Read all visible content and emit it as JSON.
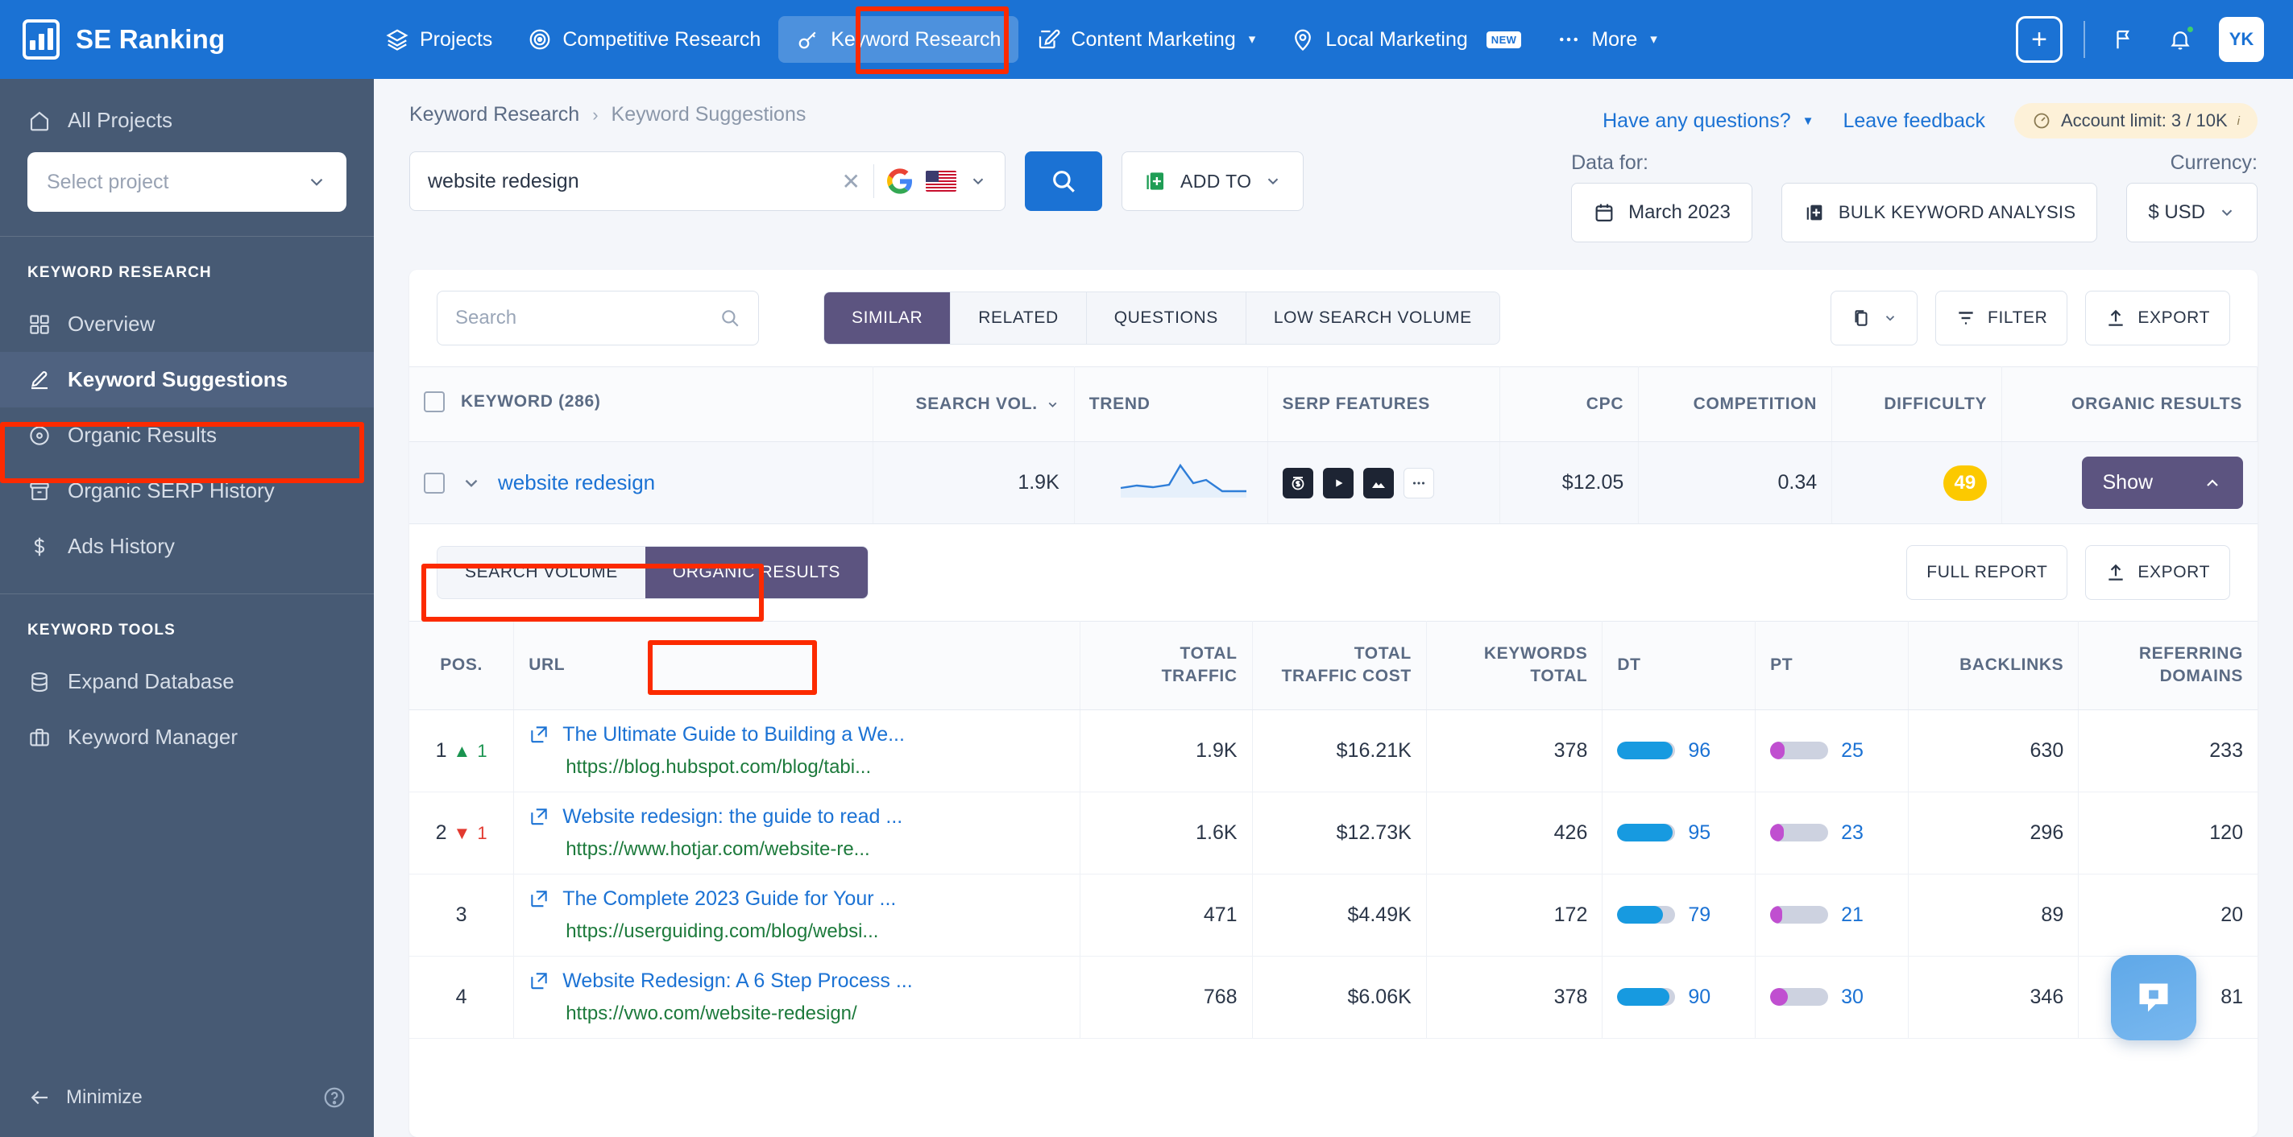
{
  "topnav": {
    "brand": "SE Ranking",
    "items": [
      {
        "label": "Projects",
        "icon": "layers-icon",
        "caret": false,
        "badge": null,
        "active": false
      },
      {
        "label": "Competitive Research",
        "icon": "target-icon",
        "caret": false,
        "badge": null,
        "active": false
      },
      {
        "label": "Keyword Research",
        "icon": "key-icon",
        "caret": false,
        "badge": null,
        "active": true
      },
      {
        "label": "Content Marketing",
        "icon": "pen-square-icon",
        "caret": true,
        "badge": null,
        "active": false
      },
      {
        "label": "Local Marketing",
        "icon": "map-pin-icon",
        "caret": false,
        "badge": "NEW",
        "active": false
      },
      {
        "label": "More",
        "icon": "ellipsis-icon",
        "caret": true,
        "badge": null,
        "active": false
      }
    ],
    "plus": "+",
    "avatar": "YK"
  },
  "sidebar": {
    "all_projects": "All Projects",
    "project_select_placeholder": "Select project",
    "group1_title": "KEYWORD RESEARCH",
    "group1_items": [
      {
        "label": "Overview",
        "icon": "grid-icon",
        "active": false
      },
      {
        "label": "Keyword Suggestions",
        "icon": "pencil-icon",
        "active": true
      },
      {
        "label": "Organic Results",
        "icon": "circle-dot-icon",
        "active": false
      },
      {
        "label": "Organic SERP History",
        "icon": "archive-icon",
        "active": false
      },
      {
        "label": "Ads History",
        "icon": "dollar-icon",
        "active": false
      }
    ],
    "group2_title": "KEYWORD TOOLS",
    "group2_items": [
      {
        "label": "Expand Database",
        "icon": "database-icon",
        "active": false
      },
      {
        "label": "Keyword Manager",
        "icon": "briefcase-icon",
        "active": false
      }
    ],
    "minimize": "Minimize"
  },
  "header": {
    "breadcrumb_root": "Keyword Research",
    "breadcrumb_current": "Keyword Suggestions",
    "have_questions": "Have any questions?",
    "leave_feedback": "Leave feedback",
    "account_limit": "Account limit: 3 / 10K"
  },
  "search": {
    "keyword_value": "website redesign",
    "clear": "✕",
    "add_to": "ADD TO",
    "data_for_label": "Data for:",
    "date_value": "March 2023",
    "bulk_analysis": "BULK KEYWORD ANALYSIS",
    "currency_label": "Currency:",
    "currency_value": "$ USD"
  },
  "toolbar": {
    "search_placeholder": "Search",
    "tabs": [
      {
        "label": "SIMILAR",
        "active": true
      },
      {
        "label": "RELATED",
        "active": false
      },
      {
        "label": "QUESTIONS",
        "active": false
      },
      {
        "label": "LOW SEARCH VOLUME",
        "active": false
      }
    ],
    "filter": "FILTER",
    "export": "EXPORT"
  },
  "keyword_table": {
    "columns": [
      "KEYWORD  (286)",
      "SEARCH VOL.",
      "TREND",
      "SERP FEATURES",
      "CPC",
      "COMPETITION",
      "DIFFICULTY",
      "ORGANIC RESULTS"
    ],
    "row": {
      "keyword": "website redesign",
      "search_volume": "1.9K",
      "serp_features": [
        "price-icon",
        "video-icon",
        "image-icon",
        "more-icon"
      ],
      "cpc": "$12.05",
      "competition": "0.34",
      "difficulty": "49",
      "show_button": "Show"
    }
  },
  "detail": {
    "subtabs": [
      {
        "label": "SEARCH VOLUME",
        "active": false
      },
      {
        "label": "ORGANIC RESULTS",
        "active": true
      }
    ],
    "full_report": "FULL REPORT",
    "export": "EXPORT",
    "columns": [
      "POS.",
      "URL",
      "TOTAL TRAFFIC",
      "TOTAL TRAFFIC COST",
      "KEYWORDS TOTAL",
      "DT",
      "PT",
      "BACKLINKS",
      "REFERRING DOMAINS"
    ],
    "rows": [
      {
        "pos": "1",
        "delta": "1",
        "delta_dir": "up",
        "title": "The Ultimate Guide to Building a We...",
        "url": "https://blog.hubspot.com/blog/tabi...",
        "total_traffic": "1.9K",
        "total_traffic_cost": "$16.21K",
        "keywords_total": "378",
        "dt": "96",
        "pt": "25",
        "backlinks": "630",
        "referring_domains": "233"
      },
      {
        "pos": "2",
        "delta": "1",
        "delta_dir": "down",
        "title": "Website redesign: the guide to read ...",
        "url": "https://www.hotjar.com/website-re...",
        "total_traffic": "1.6K",
        "total_traffic_cost": "$12.73K",
        "keywords_total": "426",
        "dt": "95",
        "pt": "23",
        "backlinks": "296",
        "referring_domains": "120"
      },
      {
        "pos": "3",
        "delta": "",
        "delta_dir": "none",
        "title": "The Complete 2023 Guide for Your ...",
        "url": "https://userguiding.com/blog/websi...",
        "total_traffic": "471",
        "total_traffic_cost": "$4.49K",
        "keywords_total": "172",
        "dt": "79",
        "pt": "21",
        "backlinks": "89",
        "referring_domains": "20"
      },
      {
        "pos": "4",
        "delta": "",
        "delta_dir": "none",
        "title": "Website Redesign: A 6 Step Process ...",
        "url": "https://vwo.com/website-redesign/",
        "total_traffic": "768",
        "total_traffic_cost": "$6.06K",
        "keywords_total": "378",
        "dt": "90",
        "pt": "30",
        "backlinks": "346",
        "referring_domains": "81"
      }
    ]
  },
  "colors": {
    "brand_blue": "#1b72d4",
    "sidebar": "#475a74",
    "accent_purple": "#5c5480",
    "difficulty_yellow": "#fcc900",
    "annotation_red": "#fc2a00",
    "link_green": "#1d7a3c",
    "dt_bar": "#179ae0",
    "pt_bar": "#c04fd0"
  }
}
